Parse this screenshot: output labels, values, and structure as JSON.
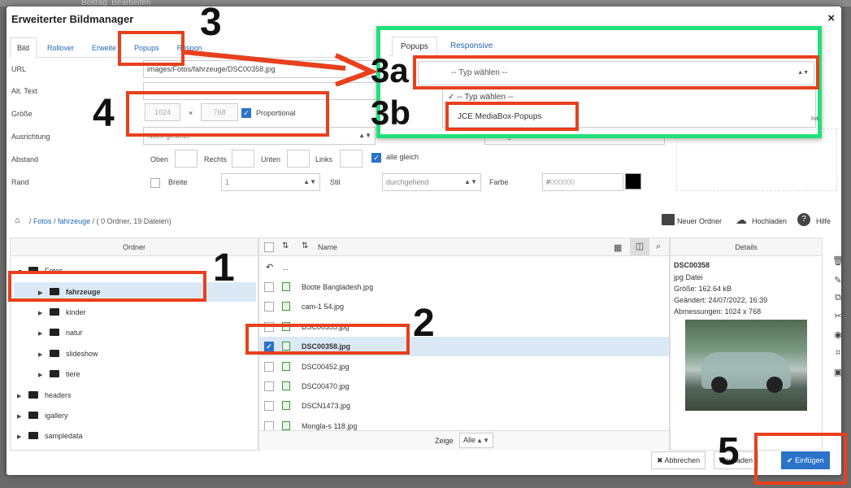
{
  "background": {
    "title": "Beitrag: Bearbeiten"
  },
  "dialog": {
    "title": "Erweiterter Bildmanager",
    "close": "×"
  },
  "tabs": [
    "Bild",
    "Rollover",
    "Erweite",
    "Popups",
    "Respon"
  ],
  "form": {
    "url_label": "URL",
    "url_value": "images/Fotos/fahrzeuge/DSC00358.jpg",
    "alt_label": "Alt. Text",
    "size_label": "Größe",
    "width": "1024",
    "times": "×",
    "height": "768",
    "proportional": "Proportional",
    "align_label": "Ausrichtung",
    "align_value": "Nicht gesetzt",
    "spacing_label": "Abstand",
    "top": "Oben",
    "right": "Rechts",
    "bottom": "Unten",
    "left": "Links",
    "all_equal": "alle gleich",
    "border_label": "Rand",
    "border_width": "Breite",
    "border_width_value": "1",
    "style": "Stil",
    "style_value": "durchgehend",
    "color": "Farbe",
    "color_hash": "#",
    "color_value": "000000",
    "swatch_color": "#000000"
  },
  "popup_panel": {
    "tabs": [
      "Popups",
      "Responsive"
    ],
    "select_value": "-- Typ wählen --",
    "options": [
      "-- Typ wählen --",
      "JCE MediaBox-Popups"
    ],
    "side_text": "na"
  },
  "breadcrumb": {
    "sep": "/",
    "path": [
      "Fotos",
      "fahrzeuge"
    ],
    "summary": "( 0 Ordner, 19 Dateien)"
  },
  "toolbar": {
    "new_folder": "Neuer Ordner",
    "upload": "Hochladen",
    "help": "Hilfe"
  },
  "folders": {
    "header": "Ordner",
    "items": [
      {
        "name": "Fotos",
        "level": 0,
        "open": true
      },
      {
        "name": "fahrzeuge",
        "level": 1,
        "selected": true
      },
      {
        "name": "kinder",
        "level": 1
      },
      {
        "name": "natur",
        "level": 1
      },
      {
        "name": "slideshow",
        "level": 1
      },
      {
        "name": "tiere",
        "level": 1
      },
      {
        "name": "headers",
        "level": 0
      },
      {
        "name": "igallery",
        "level": 0
      },
      {
        "name": "sampledata",
        "level": 0
      }
    ]
  },
  "files": {
    "name_header": "Name",
    "up": "...",
    "items": [
      {
        "name": "Boote Bangladesh.jpg",
        "checked": false
      },
      {
        "name": "cam-1 54.jpg",
        "checked": false
      },
      {
        "name": "DSC00355.jpg",
        "checked": false
      },
      {
        "name": "DSC00358.jpg",
        "checked": true
      },
      {
        "name": "DSC00452.jpg",
        "checked": false
      },
      {
        "name": "DSC00470.jpg",
        "checked": false
      },
      {
        "name": "DSCN1473.jpg",
        "checked": false
      },
      {
        "name": "Mongla-s 118.jpg",
        "checked": false
      }
    ],
    "show_label": "Zeige",
    "show_value": "Alle"
  },
  "details": {
    "header": "Details",
    "name": "DSC00358",
    "type": "jpg Datei",
    "size": "Größe: 162.64 kB",
    "changed": "Geändert: 24/07/2022, 16:39",
    "dims": "Abmessungen: 1024 x 768"
  },
  "buttons": {
    "cancel": "Abbrechen",
    "refresh": "Neu laden",
    "insert": "Einfügen"
  },
  "annotations": [
    "1",
    "2",
    "3",
    "3a",
    "3b",
    "4",
    "5"
  ],
  "colors": {
    "accent": "#2a73c9",
    "annotation_red": "#e8401c",
    "annotation_green": "#22e07a"
  }
}
